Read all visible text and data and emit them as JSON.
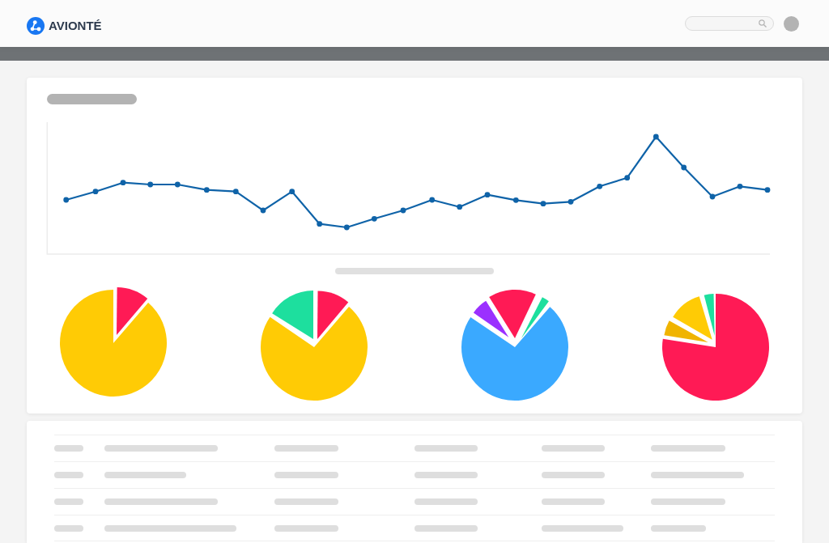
{
  "header": {
    "logo_text": "AVIONTÉ"
  }
}
